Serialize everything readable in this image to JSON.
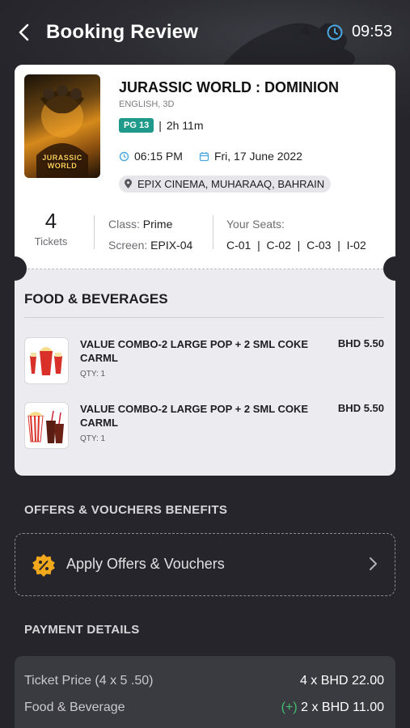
{
  "header": {
    "title": "Booking Review",
    "timer": "09:53"
  },
  "movie": {
    "title": "JURASSIC WORLD : DOMINION",
    "language": "ENGLISH, 3D",
    "rating": "PG 13",
    "duration": "2h 11m",
    "time": "06:15 PM",
    "date": "Fri, 17 June 2022",
    "venue": "EPIX CINEMA, MUHARAAQ, BAHRAIN",
    "poster_text": "JURASSIC WORLD"
  },
  "booking": {
    "ticket_count": "4",
    "ticket_label": "Tickets",
    "class_label": "Class:",
    "class_value": "Prime",
    "screen_label": "Screen:",
    "screen_value": "EPIX-04",
    "seats_label": "Your Seats:",
    "seats": "C-01  |  C-02  |  C-03  |  I-02"
  },
  "food": {
    "title": "FOOD & BEVERAGES",
    "items": [
      {
        "name": "VALUE COMBO-2 LARGE POP + 2 SML COKE CARML",
        "qty": "QTY: 1",
        "price": "BHD 5.50"
      },
      {
        "name": "VALUE COMBO-2 LARGE POP + 2 SML COKE CARML",
        "qty": "QTY: 1",
        "price": "BHD 5.50"
      }
    ]
  },
  "offers": {
    "section_title": "OFFERS & VOUCHERS BENEFITS",
    "button_label": "Apply Offers & Vouchers"
  },
  "payment": {
    "section_title": "PAYMENT DETAILS",
    "rows": [
      {
        "label": "Ticket Price (4 x 5 .50)",
        "prefix": "",
        "value": "4 x BHD 22.00"
      },
      {
        "label": "Food & Beverage",
        "prefix": "(+)",
        "value": "2 x BHD 11.00"
      }
    ]
  },
  "colors": {
    "background": "#25252b",
    "accent_clock": "#4aa8e0",
    "rating_badge": "#1f9a8a",
    "offer_icon": "#f2a81d",
    "plus_green": "#3fbf6f"
  }
}
